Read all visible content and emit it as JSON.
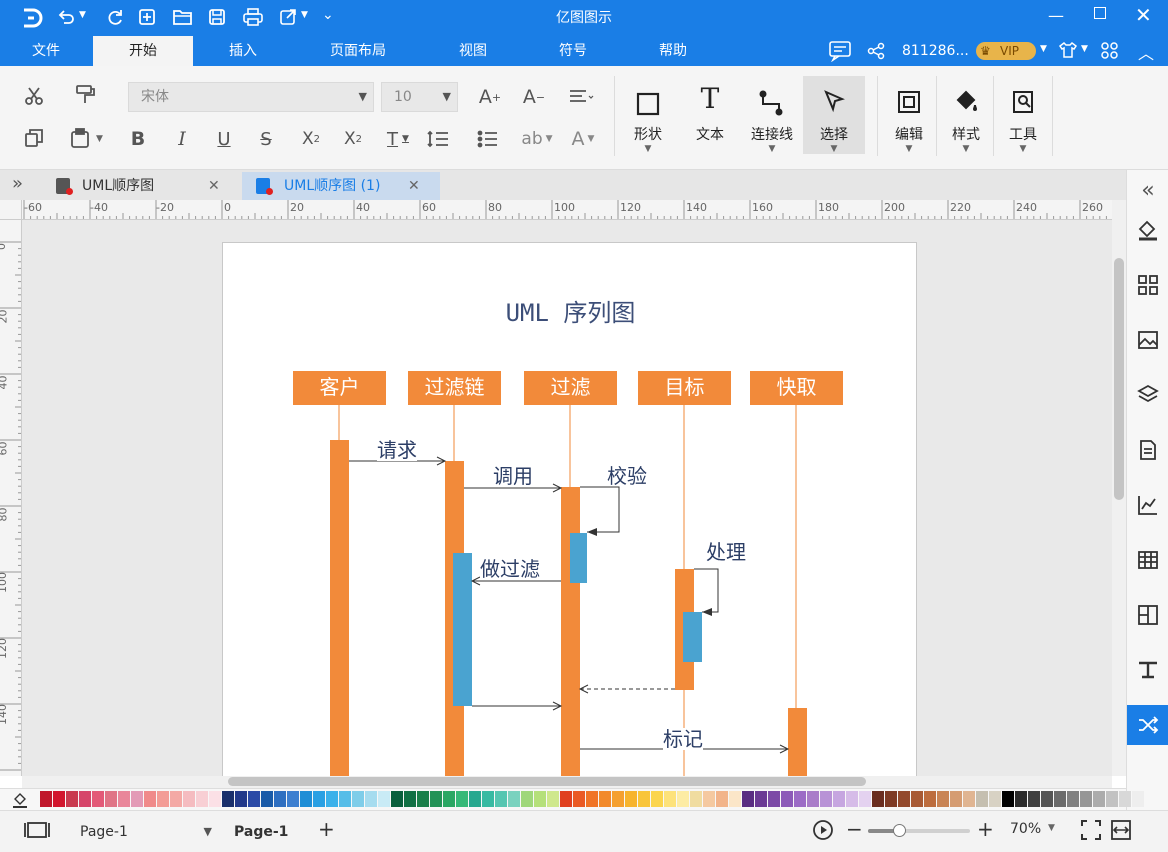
{
  "window": {
    "title": "亿图图示"
  },
  "titlebar": {
    "logo": "D"
  },
  "menu": {
    "items": [
      "文件",
      "开始",
      "插入",
      "页面布局",
      "视图",
      "符号",
      "帮助"
    ],
    "active_index": 1,
    "user_id": "811286...",
    "vip": "VIP"
  },
  "toolbar": {
    "font_family": "宋体",
    "font_size": "10",
    "big_buttons": [
      "形状",
      "文本",
      "连接线",
      "选择",
      "编辑",
      "样式",
      "工具"
    ]
  },
  "tabs": [
    {
      "label": "UML顺序图",
      "active": false
    },
    {
      "label": "UML顺序图 (1)",
      "active": true
    }
  ],
  "ruler": {
    "h_labels": [
      "-60",
      "-40",
      "-20",
      "0",
      "20",
      "40",
      "60",
      "80",
      "100",
      "120",
      "140",
      "160",
      "180",
      "200",
      "220",
      "240",
      "260"
    ],
    "v_labels": [
      "0",
      "20",
      "40",
      "60",
      "80",
      "100",
      "120",
      "140"
    ]
  },
  "diagram": {
    "title": "UML 序列图",
    "lifelines": [
      "客户",
      "过滤链",
      "过滤",
      "目标",
      "快取"
    ],
    "messages": [
      "请求",
      "调用",
      "校验",
      "做过滤",
      "处理",
      "标记"
    ],
    "colors": {
      "lifeline": "#f28a3a",
      "activation_blue": "#4aa3d0",
      "text": "#2c3e66"
    }
  },
  "palette": {
    "colors": [
      "#c0172b",
      "#d2152d",
      "#c93a4f",
      "#d6456a",
      "#e35a78",
      "#e07486",
      "#e9869a",
      "#e39ab6",
      "#f08a8a",
      "#f39c96",
      "#f4a9a5",
      "#f5bcc0",
      "#f8cfd4",
      "#fbe0e6",
      "#1a2f6b",
      "#22398a",
      "#2b4aa6",
      "#1a5ba8",
      "#2e6fc1",
      "#3d7fd0",
      "#1f8ed6",
      "#2aa0e3",
      "#3bb1ea",
      "#56bde8",
      "#7fcde9",
      "#a6dcef",
      "#c9ebf6",
      "#0a5f3c",
      "#117044",
      "#1a7f4a",
      "#239257",
      "#2ba764",
      "#36b978",
      "#27a88f",
      "#37baa2",
      "#55c6b1",
      "#7ad2bf",
      "#9fd77a",
      "#b5e07a",
      "#cfe88c",
      "#e0401f",
      "#ea5a24",
      "#f07426",
      "#f28a2b",
      "#f5a02f",
      "#f7b42d",
      "#f9c53a",
      "#fbd54e",
      "#fde27a",
      "#fdeca4",
      "#f0dca0",
      "#f5c9a0",
      "#f2b48a",
      "#fbe6c8",
      "#5a2d82",
      "#6b3a94",
      "#7c4aa6",
      "#8c5ab8",
      "#9c6bc6",
      "#a97cc9",
      "#b892d6",
      "#c6a6e0",
      "#d6bce8",
      "#e4d2f0",
      "#6b2d1f",
      "#7e3a24",
      "#93492c",
      "#a85a34",
      "#bd6d3e",
      "#c98455",
      "#d59c72",
      "#e0b592",
      "#c5bfb0",
      "#d8d2c4",
      "#000000",
      "#2b2b2b",
      "#404040",
      "#555555",
      "#6b6b6b",
      "#808080",
      "#969696",
      "#acacac",
      "#c2c2c2",
      "#d8d8d8",
      "#eeeeee"
    ]
  },
  "statusbar": {
    "page_select": "Page-1",
    "page_tab": "Page-1",
    "zoom": "70%",
    "zoom_level": 0.3
  }
}
